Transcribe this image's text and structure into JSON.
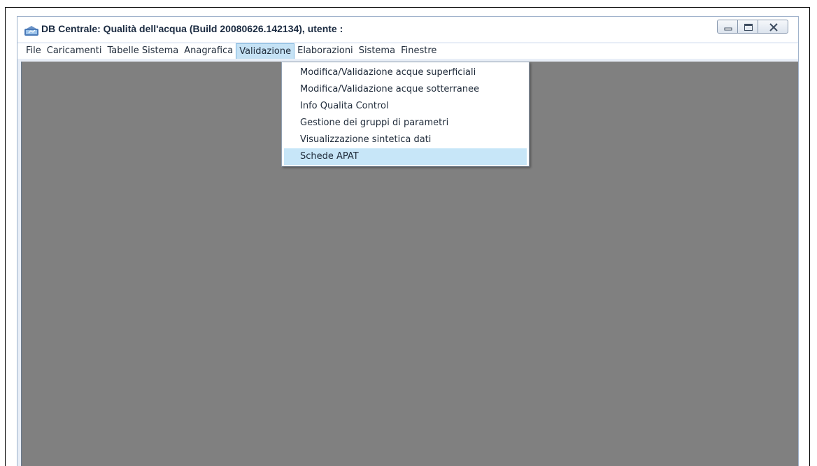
{
  "window": {
    "title": "DB Centrale: Qualità dell'acqua (Build 20080626.142134), utente :"
  },
  "caption": {
    "minimize_icon": "minimize-icon",
    "maximize_icon": "maximize-icon",
    "close_icon": "close-icon"
  },
  "menubar": {
    "file": "File",
    "caricamenti": "Caricamenti",
    "tabelle_sistema": "Tabelle Sistema",
    "anagrafica": "Anagrafica",
    "validazione": "Validazione",
    "elaborazioni": "Elaborazioni",
    "sistema": "Sistema",
    "finestre": "Finestre"
  },
  "validazione_menu": {
    "items": [
      "Modifica/Validazione acque superficiali",
      "Modifica/Validazione acque sotterranee",
      "Info Qualita Control",
      "Gestione dei gruppi di parametri",
      "Visualizzazione sintetica dati",
      "Schede APAT"
    ],
    "highlighted": "Schede APAT"
  },
  "colors": {
    "client_background": "#808080",
    "menu_highlight": "#c7e6f8",
    "menu_open": "#c5e2f5"
  }
}
